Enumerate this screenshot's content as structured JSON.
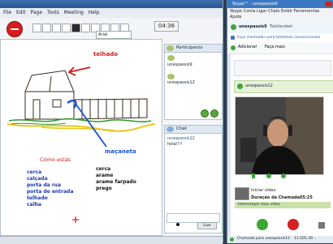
{
  "whiteboard": {
    "menu": [
      "File",
      "Edit",
      "Page",
      "Tools",
      "Meeting",
      "Help"
    ],
    "timer": "04:36",
    "font_select": "Arial",
    "drawing": {
      "label_roof": "telhado",
      "label_gate": "maçaneta",
      "greeting": "Cómo estás",
      "word_list_left": [
        "cerca",
        "calçada",
        "porta da rua",
        "porta de entrada",
        "telhado",
        "calha"
      ],
      "word_list_right": [
        "cerca",
        "arame",
        "arame farpado",
        "prego"
      ]
    }
  },
  "participants_panel": {
    "title": "Participants",
    "users": [
      "unespassis9",
      "unespassis12"
    ]
  },
  "chat_panel": {
    "title": "Chat",
    "messages": [
      {
        "user": "unespassis12",
        "text": "hola!!!!"
      }
    ],
    "send_label": "Live"
  },
  "skype": {
    "title": "Skype™ - unespassis9",
    "menu": [
      "Skype",
      "Conta",
      "Ligar",
      "Chats",
      "Exibir",
      "Ferramentas",
      "Ajuda"
    ],
    "current_user": "unespassis9",
    "current_user_status": "Telefandwri",
    "call_phones": "Faça chamadas para telefones convencionais",
    "add_label": "Adicionar",
    "more_label": "Faça mais",
    "contact_name": "unespassis12",
    "start_video_label": "Iniciar vídeo",
    "call_duration": "Duração da Chamada05:25",
    "interrupt_video": "Interromper meu vídeo",
    "bottom_status": "Chamada para unespassis12",
    "bottom_time": "11.505.39...",
    "colors": {
      "call_red": "#d32020",
      "call_green": "#3aa636",
      "accent": "#3c78c3"
    }
  }
}
